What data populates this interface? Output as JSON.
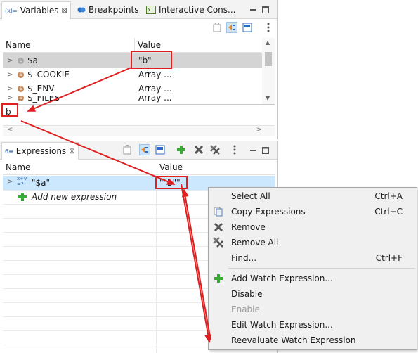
{
  "variables_panel": {
    "tabs": [
      {
        "label": "Variables",
        "icon": "variables-icon",
        "close": "⊠"
      },
      {
        "label": "Breakpoints",
        "icon": "breakpoints-icon"
      },
      {
        "label": "Interactive Cons..."
      }
    ],
    "columns": [
      "Name",
      "Value"
    ],
    "rows": [
      {
        "name": "$a",
        "value": "\"b\"",
        "selected": true
      },
      {
        "name": "$_COOKIE",
        "value": "Array ..."
      },
      {
        "name": "$_ENV",
        "value": "Array ..."
      },
      {
        "name": "$_FILES",
        "value": "Array ..."
      }
    ],
    "detail_text": "b"
  },
  "expressions_panel": {
    "tab_label": "Expressions",
    "columns": [
      "Name",
      "Value"
    ],
    "rows": [
      {
        "name": "\"$a\"",
        "value": "\"\"b\"\"",
        "selected": true
      }
    ],
    "add_label": "Add new expression"
  },
  "context_menu": {
    "items": [
      {
        "label": "Select All",
        "accel": "Ctrl+A"
      },
      {
        "label": "Copy Expressions",
        "accel": "Ctrl+C",
        "icon": "copy-icon"
      },
      {
        "label": "Remove",
        "icon": "remove-icon"
      },
      {
        "label": "Remove All",
        "icon": "remove-all-icon"
      },
      {
        "label": "Find...",
        "accel": "Ctrl+F"
      },
      {
        "label": "Add Watch Expression...",
        "icon": "add-icon"
      },
      {
        "label": "Disable"
      },
      {
        "label": "Enable",
        "disabled": true
      },
      {
        "label": "Edit Watch Expression..."
      },
      {
        "label": "Reevaluate Watch Expression"
      }
    ]
  },
  "colors": {
    "selection": "#d4d4d4",
    "selection_blue": "#cce8ff",
    "annotation_red": "#e02020",
    "add_green": "#3aa935"
  }
}
